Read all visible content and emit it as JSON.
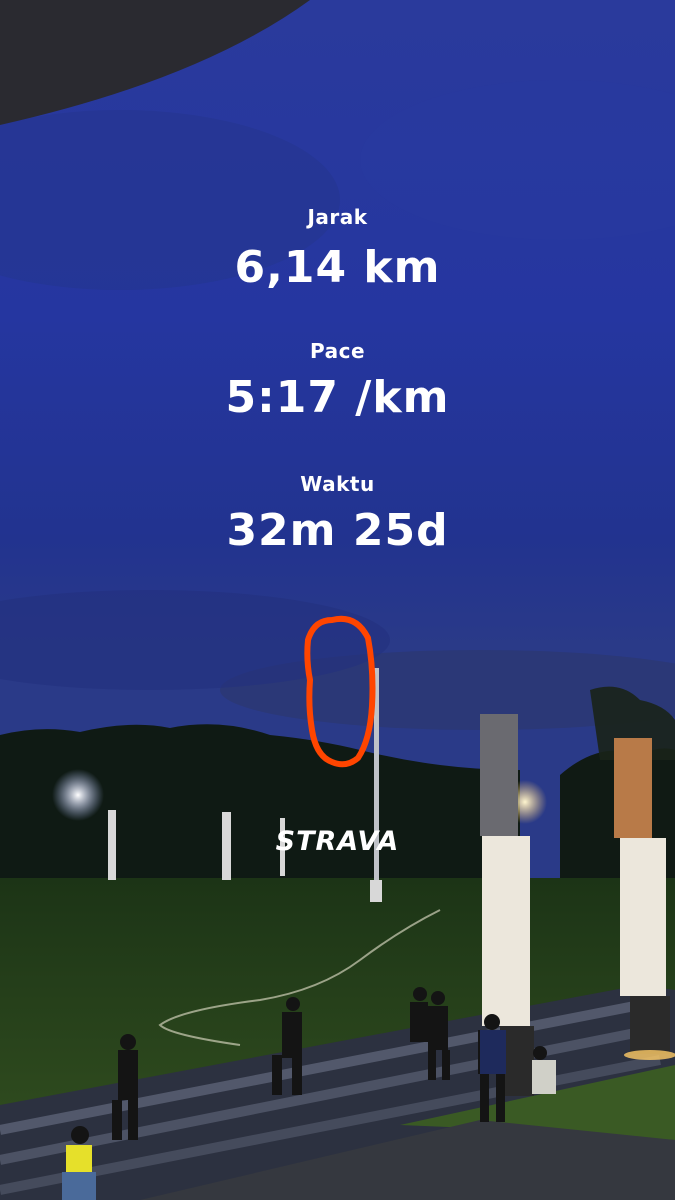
{
  "stats": [
    {
      "label": "Jarak",
      "value": "6,14 km"
    },
    {
      "label": "Pace",
      "value": "5:17 /km"
    },
    {
      "label": "Waktu",
      "value": "32m 25d"
    }
  ],
  "route_color": "#ff4500",
  "brand": "STRAVA"
}
